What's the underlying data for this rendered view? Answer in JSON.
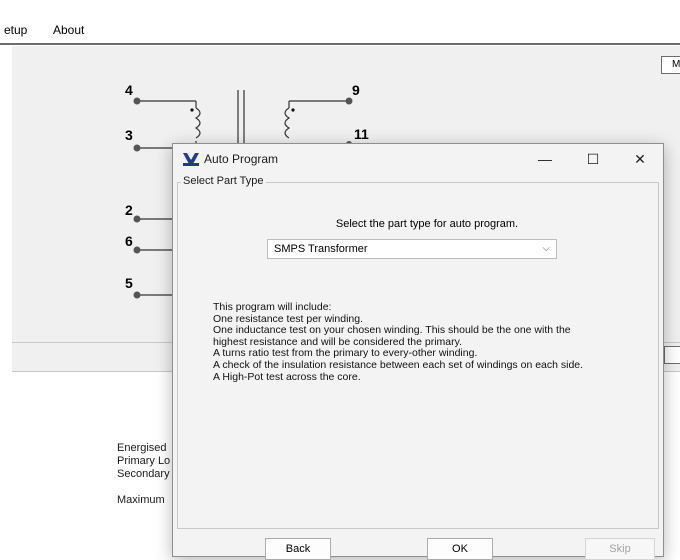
{
  "menu": {
    "items": [
      "etup",
      "About"
    ]
  },
  "right_box_label": "M",
  "schematic": {
    "pins": [
      "4",
      "3",
      "2",
      "6",
      "5",
      "9",
      "11"
    ]
  },
  "info_lines": [
    "Energised",
    "Primary Lo",
    "Secondary",
    "Maximum"
  ],
  "dialog": {
    "title": "Auto Program",
    "controls": {
      "minimize": "—",
      "maximize": "☐",
      "close": "✕"
    },
    "group_label": "Select Part Type",
    "prompt": "Select the part type for auto program.",
    "part_type": {
      "selected": "SMPS Transformer"
    },
    "description": [
      "This program will include:",
      "One resistance test per winding.",
      "One inductance test on your chosen winding. This should be the one with the",
      "highest resistance and will be considered the primary.",
      "A turns ratio test from the primary to every-other winding.",
      "A check of the insulation resistance between each set of windings on each side.",
      "A High-Pot test across the core."
    ],
    "buttons": {
      "back": "Back",
      "ok": "OK",
      "skip": "Skip"
    }
  },
  "colors": {
    "accent": "#1f3b8c",
    "canvas_bg": "#f0f0f0",
    "dialog_bg": "#f3f3f3"
  }
}
